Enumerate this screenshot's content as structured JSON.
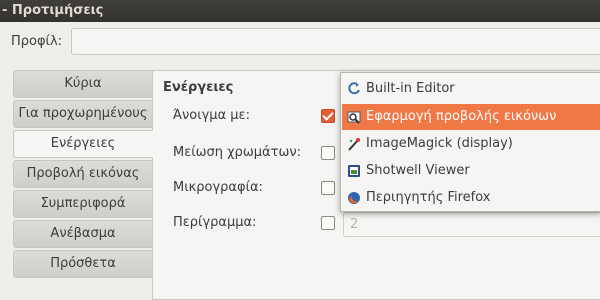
{
  "window": {
    "title": "- Προτιμήσεις"
  },
  "profile": {
    "label": "Προφίλ:",
    "value": ""
  },
  "tabs": [
    {
      "label": "Κύρια",
      "active": false
    },
    {
      "label": "Για προχωρημένους",
      "active": false
    },
    {
      "label": "Ενέργειες",
      "active": true
    },
    {
      "label": "Προβολή εικόνας",
      "active": false
    },
    {
      "label": "Συμπεριφορά",
      "active": false
    },
    {
      "label": "Ανέβασμα",
      "active": false
    },
    {
      "label": "Πρόσθετα",
      "active": false
    }
  ],
  "actions": {
    "title": "Ενέργειες",
    "open_with": {
      "label": "Άνοιγμα με:",
      "checked": true
    },
    "reduce_colors": {
      "label": "Μείωση χρωμάτων:",
      "checked": false
    },
    "thumbnail": {
      "label": "Μικρογραφία:",
      "checked": false
    },
    "border": {
      "label": "Περίγραμμα:",
      "checked": false,
      "value": "2"
    }
  },
  "open_with_menu": {
    "items": [
      {
        "label": "Built-in Editor",
        "icon": "editor-icon",
        "highlighted": false
      },
      {
        "label": "Εφαρμογή προβολής εικόνων",
        "icon": "image-viewer-icon",
        "highlighted": true
      },
      {
        "label": "ImageMagick (display)",
        "icon": "imagemagick-icon",
        "highlighted": false
      },
      {
        "label": "Shotwell Viewer",
        "icon": "shotwell-icon",
        "highlighted": false
      },
      {
        "label": "Περιηγητής Firefox",
        "icon": "firefox-icon",
        "highlighted": false
      }
    ]
  },
  "colors": {
    "accent": "#e45e33",
    "highlight": "#f07746",
    "titlebar": "#3c3b37"
  }
}
